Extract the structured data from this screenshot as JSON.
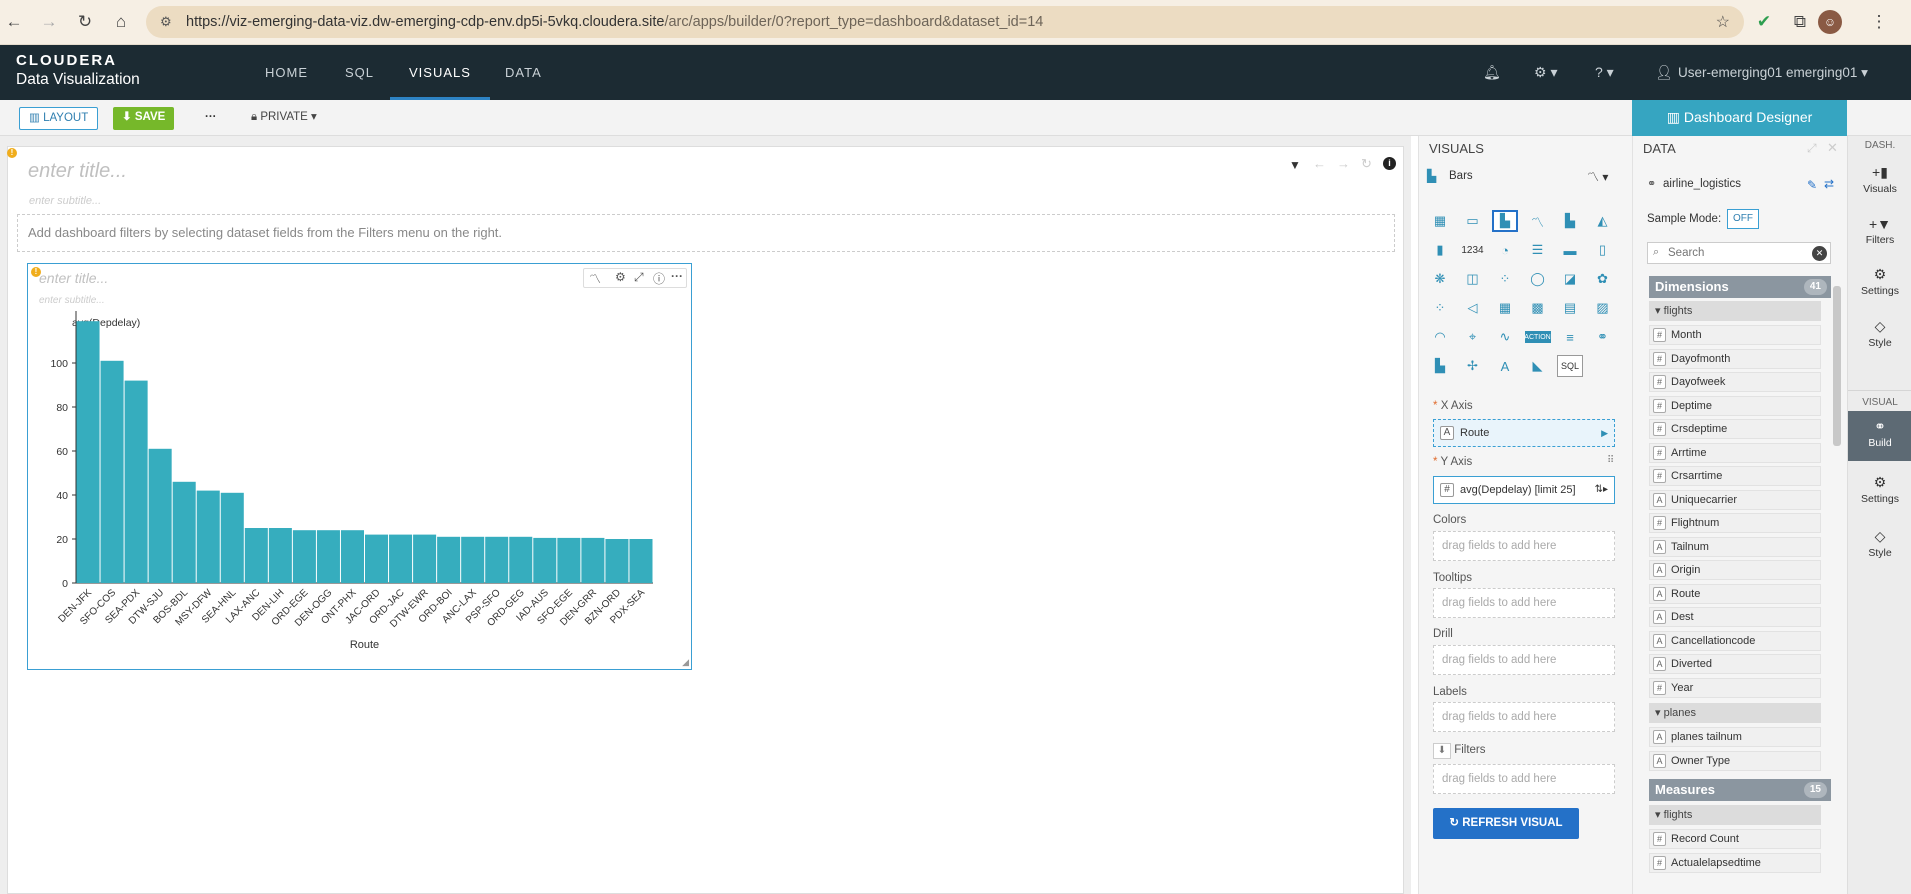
{
  "browser": {
    "url_host": "https://viz-emerging-data-viz.dw-emerging-cdp-env.dp5i-5vkq.cloudera.site",
    "url_path": "/arc/apps/builder/0?report_type=dashboard&dataset_id=14"
  },
  "app": {
    "logo_brand": "CLOUDERA",
    "logo_product": "Data Visualization",
    "nav": [
      "HOME",
      "SQL",
      "VISUALS",
      "DATA"
    ],
    "user": "User-emerging01 emerging01"
  },
  "toolbar": {
    "layout_label": "LAYOUT",
    "save_label": "SAVE",
    "more_label": "···",
    "private_label": "PRIVATE",
    "designer_label": "Dashboard Designer"
  },
  "dashboard": {
    "title_placeholder": "enter title...",
    "subtitle_placeholder": "enter subtitle...",
    "filters_hint": "Add dashboard filters by selecting dataset fields from the Filters menu on the right."
  },
  "visual": {
    "title_placeholder": "enter title...",
    "subtitle_placeholder": "enter subtitle..."
  },
  "chart_data": {
    "type": "bar",
    "series_label": "avg(Depdelay)",
    "xlabel": "Route",
    "ylabel": "",
    "ylim": [
      0,
      120
    ],
    "yticks": [
      0,
      20,
      40,
      60,
      80,
      100
    ],
    "categories": [
      "DEN-JFK",
      "SFO-COS",
      "SEA-PDX",
      "DTW-SJU",
      "BOS-BDL",
      "MSY-DFW",
      "SEA-HNL",
      "LAX-ANC",
      "DEN-LIH",
      "ORD-EGE",
      "DEN-OGG",
      "ONT-PHX",
      "JAC-ORD",
      "ORD-JAC",
      "DTW-EWR",
      "ORD-BOI",
      "ANC-LAX",
      "PSP-SFO",
      "ORD-GEG",
      "IAD-AUS",
      "SFO-EGE",
      "DEN-GRR",
      "BZN-ORD",
      "PDX-SEA"
    ],
    "values": [
      119,
      101,
      92,
      61,
      46,
      42,
      41,
      25,
      25,
      24,
      24,
      24,
      22,
      22,
      22,
      21,
      21,
      21,
      21,
      20.5,
      20.5,
      20.5,
      20,
      20
    ]
  },
  "visuals_panel": {
    "header": "VISUALS",
    "selected_type": "Bars",
    "shelves": {
      "x_axis": {
        "label": "X Axis",
        "field": "Route"
      },
      "y_axis": {
        "label": "Y Axis",
        "field": "avg(Depdelay) [limit 25]"
      },
      "colors": "Colors",
      "tooltips": "Tooltips",
      "drill": "Drill",
      "labels": "Labels",
      "filters": "Filters",
      "drop_hint": "drag fields to add here"
    },
    "refresh_label": "REFRESH VISUAL",
    "icon_text_number": "1234",
    "icon_text_action": "ACTION",
    "icon_text_sql": "SQL"
  },
  "data_panel": {
    "header": "DATA",
    "dataset": "airline_logistics",
    "sample_mode_label": "Sample Mode:",
    "sample_mode_value": "OFF",
    "search_placeholder": "Search",
    "dimensions_label": "Dimensions",
    "dimensions_count": "41",
    "flights_group": "flights",
    "dimension_fields": [
      {
        "type": "#",
        "name": "Month"
      },
      {
        "type": "#",
        "name": "Dayofmonth"
      },
      {
        "type": "#",
        "name": "Dayofweek"
      },
      {
        "type": "#",
        "name": "Deptime"
      },
      {
        "type": "#",
        "name": "Crsdeptime"
      },
      {
        "type": "#",
        "name": "Arrtime"
      },
      {
        "type": "#",
        "name": "Crsarrtime"
      },
      {
        "type": "A",
        "name": "Uniquecarrier"
      },
      {
        "type": "#",
        "name": "Flightnum"
      },
      {
        "type": "A",
        "name": "Tailnum"
      },
      {
        "type": "A",
        "name": "Origin"
      },
      {
        "type": "A",
        "name": "Route"
      },
      {
        "type": "A",
        "name": "Dest"
      },
      {
        "type": "A",
        "name": "Cancellationcode"
      },
      {
        "type": "A",
        "name": "Diverted"
      },
      {
        "type": "#",
        "name": "Year"
      }
    ],
    "planes_group": "planes",
    "planes_fields": [
      {
        "type": "A",
        "name": "planes tailnum"
      },
      {
        "type": "A",
        "name": "Owner Type"
      }
    ],
    "measures_label": "Measures",
    "measures_count": "15",
    "measures_group": "flights",
    "measure_fields": [
      {
        "type": "#",
        "name": "Record Count"
      },
      {
        "type": "#",
        "name": "Actualelapsedtime"
      }
    ]
  },
  "rail": {
    "dash_label": "DASH.",
    "visual_label": "VISUAL",
    "dash_items": [
      "Visuals",
      "Filters",
      "Settings",
      "Style"
    ],
    "visual_items": [
      "Build",
      "Settings",
      "Style"
    ]
  }
}
